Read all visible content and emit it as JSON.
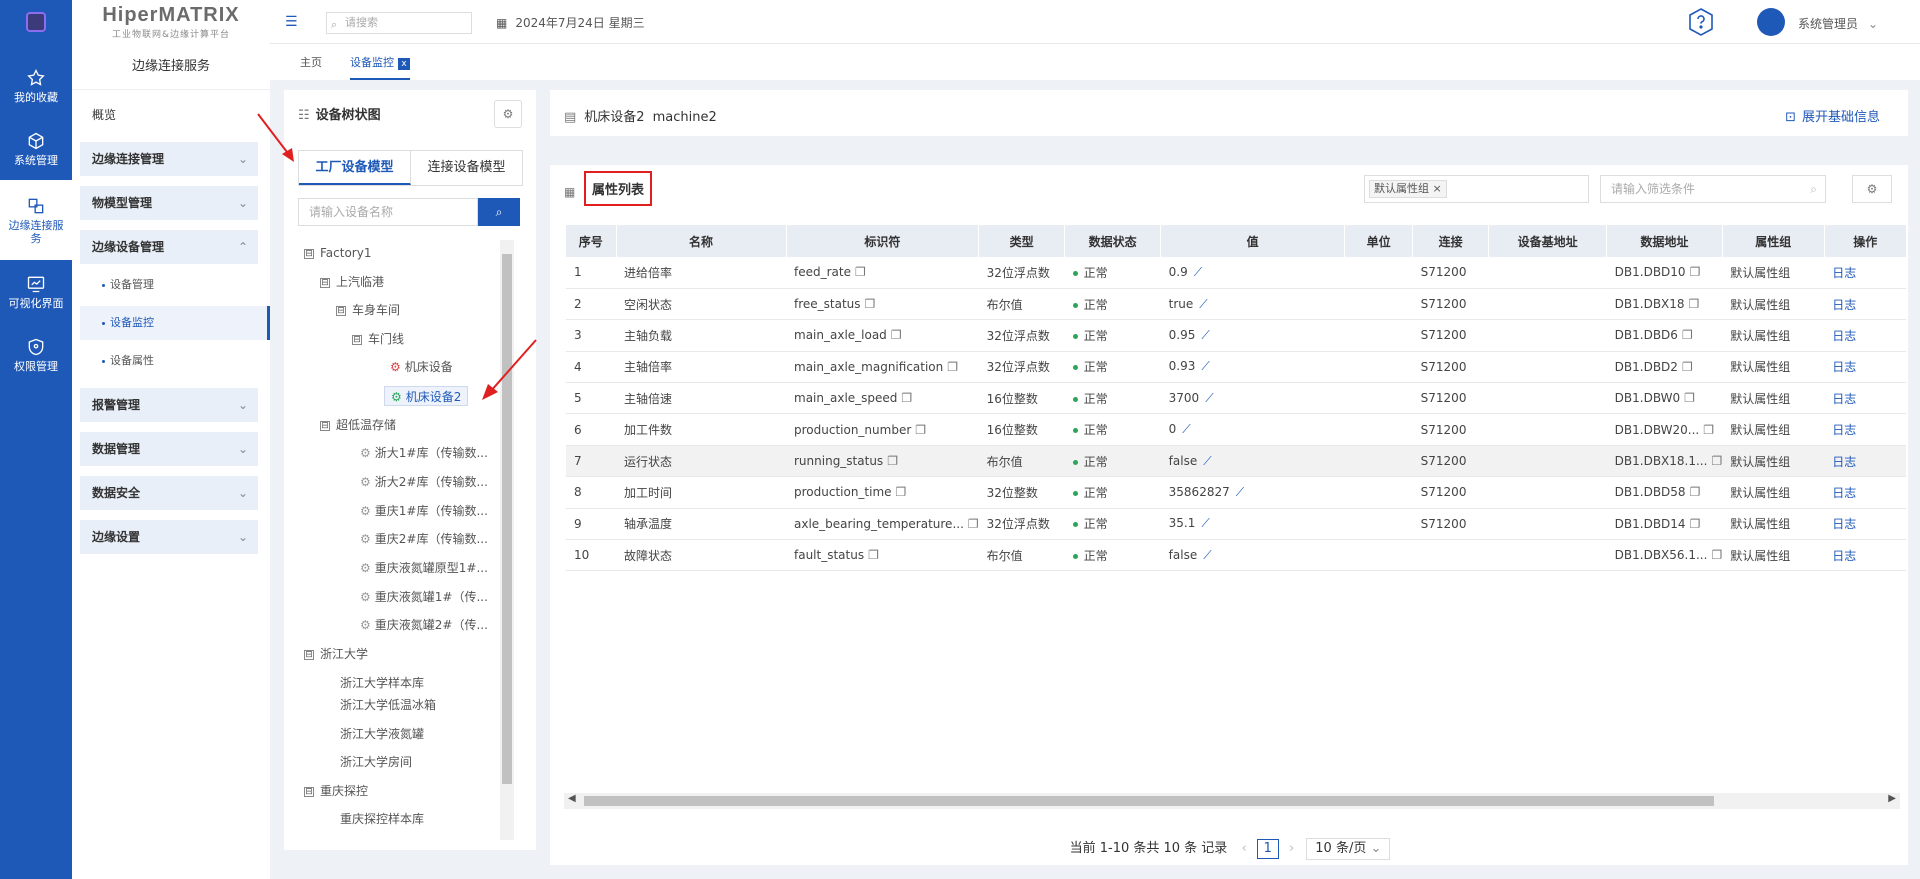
{
  "nav": {
    "items": [
      {
        "label": "我的收藏",
        "icon": "star-icon"
      },
      {
        "label": "系统管理",
        "icon": "cube-icon"
      },
      {
        "label": "边缘连接服务",
        "icon": "connect-icon"
      },
      {
        "label": "可视化界面",
        "icon": "monitor-icon"
      },
      {
        "label": "权限管理",
        "icon": "shield-icon"
      }
    ]
  },
  "brand": {
    "name": "HiperMATRIX",
    "subtitle": "工业物联网&边缘计算平台"
  },
  "sidebar": {
    "section_title": "边缘连接服务",
    "overview": "概览",
    "groups": [
      {
        "label": "边缘连接管理",
        "chev": "⌄"
      },
      {
        "label": "物模型管理",
        "chev": "⌄"
      },
      {
        "label": "边缘设备管理",
        "chev": "⌃"
      },
      {
        "label": "报警管理",
        "chev": "⌄"
      },
      {
        "label": "数据管理",
        "chev": "⌄"
      },
      {
        "label": "数据安全",
        "chev": "⌄"
      },
      {
        "label": "边缘设置",
        "chev": "⌄"
      }
    ],
    "subs": [
      "设备管理",
      "设备监控",
      "设备属性"
    ]
  },
  "header": {
    "search_placeholder": "请搜索",
    "date": "2024年7月24日 星期三",
    "user": "系统管理员"
  },
  "tabs": [
    "主页",
    "设备监控"
  ],
  "tree_panel": {
    "title": "设备树状图",
    "model_tabs": [
      "工厂设备模型",
      "连接设备模型"
    ],
    "search_placeholder": "请输入设备名称",
    "nodes": [
      {
        "label": "Factory1",
        "exp": "⊟"
      },
      {
        "label": "上汽临港",
        "exp": "⊟"
      },
      {
        "label": "车身车间",
        "exp": "⊟"
      },
      {
        "label": "车门线",
        "exp": "⊟"
      },
      {
        "label": "机床设备"
      },
      {
        "label": "机床设备2"
      },
      {
        "label": "超低温存储",
        "exp": "⊟"
      },
      {
        "label": "浙大1#库（传输数..."
      },
      {
        "label": "浙大2#库（传输数..."
      },
      {
        "label": "重庆1#库（传输数..."
      },
      {
        "label": "重庆2#库（传输数..."
      },
      {
        "label": "重庆液氮罐原型1#..."
      },
      {
        "label": "重庆液氮罐1#（传..."
      },
      {
        "label": "重庆液氮罐2#（传..."
      },
      {
        "label": "浙江大学",
        "exp": "⊟"
      },
      {
        "label": "浙江大学样本库"
      },
      {
        "label": "浙江大学低温冰箱"
      },
      {
        "label": "浙江大学液氮罐"
      },
      {
        "label": "浙江大学房间"
      },
      {
        "label": "重庆探控",
        "exp": "⊟"
      },
      {
        "label": "重庆探控样本库"
      }
    ]
  },
  "device": {
    "name": "机床设备2",
    "code": "machine2",
    "expand_label": "展开基础信息"
  },
  "attr": {
    "title": "属性列表",
    "tag": "默认属性组",
    "filter_placeholder": "请输入筛选条件",
    "columns": [
      "序号",
      "名称",
      "标识符",
      "类型",
      "数据状态",
      "值",
      "单位",
      "连接",
      "设备基地址",
      "数据地址",
      "属性组",
      "操作"
    ],
    "rows": [
      {
        "no": "1",
        "name": "进给倍率",
        "id": "feed_rate",
        "type": "32位浮点数",
        "status": "正常",
        "value": "0.9",
        "unit": "",
        "conn": "S71200",
        "base": "",
        "addr": "DB1.DBD10",
        "group": "默认属性组",
        "op": "日志"
      },
      {
        "no": "2",
        "name": "空闲状态",
        "id": "free_status",
        "type": "布尔值",
        "status": "正常",
        "value": "true",
        "unit": "",
        "conn": "S71200",
        "base": "",
        "addr": "DB1.DBX18",
        "group": "默认属性组",
        "op": "日志"
      },
      {
        "no": "3",
        "name": "主轴负载",
        "id": "main_axle_load",
        "type": "32位浮点数",
        "status": "正常",
        "value": "0.95",
        "unit": "",
        "conn": "S71200",
        "base": "",
        "addr": "DB1.DBD6",
        "group": "默认属性组",
        "op": "日志"
      },
      {
        "no": "4",
        "name": "主轴倍率",
        "id": "main_axle_magnification",
        "type": "32位浮点数",
        "status": "正常",
        "value": "0.93",
        "unit": "",
        "conn": "S71200",
        "base": "",
        "addr": "DB1.DBD2",
        "group": "默认属性组",
        "op": "日志"
      },
      {
        "no": "5",
        "name": "主轴倍速",
        "id": "main_axle_speed",
        "type": "16位整数",
        "status": "正常",
        "value": "3700",
        "unit": "",
        "conn": "S71200",
        "base": "",
        "addr": "DB1.DBW0",
        "group": "默认属性组",
        "op": "日志"
      },
      {
        "no": "6",
        "name": "加工件数",
        "id": "production_number",
        "type": "16位整数",
        "status": "正常",
        "value": "0",
        "unit": "",
        "conn": "S71200",
        "base": "",
        "addr": "DB1.DBW20...",
        "group": "默认属性组",
        "op": "日志"
      },
      {
        "no": "7",
        "name": "运行状态",
        "id": "running_status",
        "type": "布尔值",
        "status": "正常",
        "value": "false",
        "unit": "",
        "conn": "S71200",
        "base": "",
        "addr": "DB1.DBX18.1...",
        "group": "默认属性组",
        "op": "日志"
      },
      {
        "no": "8",
        "name": "加工时间",
        "id": "production_time",
        "type": "32位整数",
        "status": "正常",
        "value": "35862827",
        "unit": "",
        "conn": "S71200",
        "base": "",
        "addr": "DB1.DBD58",
        "group": "默认属性组",
        "op": "日志"
      },
      {
        "no": "9",
        "name": "轴承温度",
        "id": "axle_bearing_temperature...",
        "type": "32位浮点数",
        "status": "正常",
        "value": "35.1",
        "unit": "",
        "conn": "S71200",
        "base": "",
        "addr": "DB1.DBD14",
        "group": "默认属性组",
        "op": "日志"
      },
      {
        "no": "10",
        "name": "故障状态",
        "id": "fault_status",
        "type": "布尔值",
        "status": "正常",
        "value": "false",
        "unit": "",
        "conn": "",
        "base": "",
        "addr": "DB1.DBX56.1...",
        "group": "默认属性组",
        "op": "日志"
      }
    ]
  },
  "pager": {
    "summary": "当前 1-10 条共 10 条 记录",
    "page": "1",
    "page_size": "10 条/页"
  }
}
